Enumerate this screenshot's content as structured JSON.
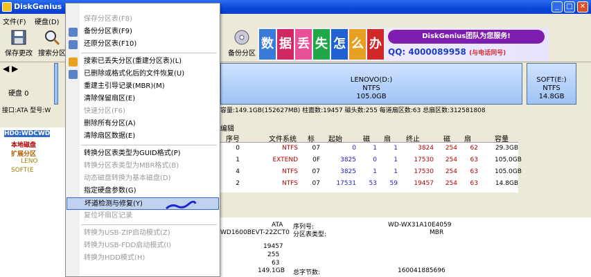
{
  "window": {
    "title": "DiskGenius"
  },
  "menubar": [
    "文件(F)",
    "硬盘(D)"
  ],
  "toolbar": {
    "save": "保存更改",
    "search": "搜索分区",
    "backup": "备份分区"
  },
  "banner": {
    "tiles": [
      "数",
      "据",
      "丢",
      "失",
      "怎",
      "么",
      "办"
    ],
    "slogan": "DiskGenius团队为您服务!",
    "qq": "QQ: 4000089958",
    "qq_sub": "(与电话同号)",
    "number": "4000089958"
  },
  "left_info": {
    "disk_label": "硬盘 0"
  },
  "partitions": [
    {
      "name": "LENOVO(D:)",
      "fs": "NTFS",
      "size": "105.0GB"
    },
    {
      "name": "SOFT(E:)",
      "fs": "NTFS",
      "size": "14.8GB"
    }
  ],
  "infoline": "接口:ATA  型号:W",
  "infoline2": "容量:149.1GB(152627MB)  柱面数:19457  磁头数:255  每道扇区数:63  总扇区数:312581808",
  "tree": [
    "HD0:WDCWD",
    "本地磁盘",
    "扩展分区",
    "LENO",
    "SOFT(E"
  ],
  "tabs": {
    "edit": "编辑"
  },
  "table": {
    "headers": [
      "序号",
      "文件系统",
      "标",
      "起始",
      "磁",
      "扇",
      "终止",
      "磁",
      "扇",
      "容量"
    ],
    "rows": [
      [
        "0",
        "NTFS",
        "07",
        "0",
        "1",
        "1",
        "3824",
        "254",
        "62",
        "29.3GB"
      ],
      [
        "1",
        "EXTEND",
        "0F",
        "3825",
        "0",
        "1",
        "17530",
        "254",
        "63",
        "105.0GB"
      ],
      [
        "4",
        "NTFS",
        "07",
        "3825",
        "1",
        "1",
        "17530",
        "254",
        "63",
        "105.0GB"
      ],
      [
        "2",
        "NTFS",
        "07",
        "17531",
        "53",
        "59",
        "19457",
        "254",
        "63",
        "14.8GB"
      ]
    ]
  },
  "details": {
    "iface": "ATA",
    "model_frag": "WD1600BEVT-22ZCT0",
    "serial_label": "序列号:",
    "serial": "WD-WX31A10E4059",
    "ptype_label": "分区表类型:",
    "ptype": "MBR",
    "cyl": "19457",
    "heads": "255",
    "spt": "63",
    "cap": "149.1GB",
    "total_bytes_label": "总字节数:",
    "total_bytes": "160041885696"
  },
  "context_menu": {
    "items": [
      {
        "label": "保存分区表(F8)",
        "disabled": true,
        "icon": ""
      },
      {
        "label": "备份分区表(F9)",
        "disabled": false,
        "icon": "backup-table-icon"
      },
      {
        "label": "还原分区表(F10)",
        "disabled": false,
        "icon": "restore-table-icon"
      },
      {
        "sep": true
      },
      {
        "label": "搜索已丢失分区(重建分区表)(L)",
        "disabled": false,
        "icon": "search-lost-icon"
      },
      {
        "label": "已删除或格式化后的文件恢复(U)",
        "disabled": false,
        "icon": "file-recovery-icon"
      },
      {
        "label": "重建主引导记录(MBR)(M)",
        "disabled": false,
        "icon": ""
      },
      {
        "label": "清除保留扇区(E)",
        "disabled": false,
        "icon": ""
      },
      {
        "label": "快速分区(F6)",
        "disabled": true,
        "icon": ""
      },
      {
        "label": "删除所有分区(A)",
        "disabled": false,
        "icon": ""
      },
      {
        "label": "清除扇区数据(E)",
        "disabled": false,
        "icon": ""
      },
      {
        "sep": true
      },
      {
        "label": "转换分区表类型为GUID格式(P)",
        "disabled": false,
        "icon": ""
      },
      {
        "label": "转换分区表类型为MBR格式(B)",
        "disabled": true,
        "icon": ""
      },
      {
        "label": "动态磁盘转换为基本磁盘(D)",
        "disabled": true,
        "icon": ""
      },
      {
        "label": "指定硬盘参数(G)",
        "disabled": false,
        "icon": ""
      },
      {
        "label": "坏道检测与修复(Y)",
        "disabled": false,
        "icon": "",
        "hover": true
      },
      {
        "label": "复位坏扇区记录",
        "disabled": true,
        "icon": ""
      },
      {
        "sep": true
      },
      {
        "label": "转换为USB-ZIP启动模式(Z)",
        "disabled": true,
        "icon": ""
      },
      {
        "label": "转换为USB-FDD启动模式(I)",
        "disabled": true,
        "icon": ""
      },
      {
        "label": "转换为HDD模式(H)",
        "disabled": true,
        "icon": ""
      }
    ]
  }
}
